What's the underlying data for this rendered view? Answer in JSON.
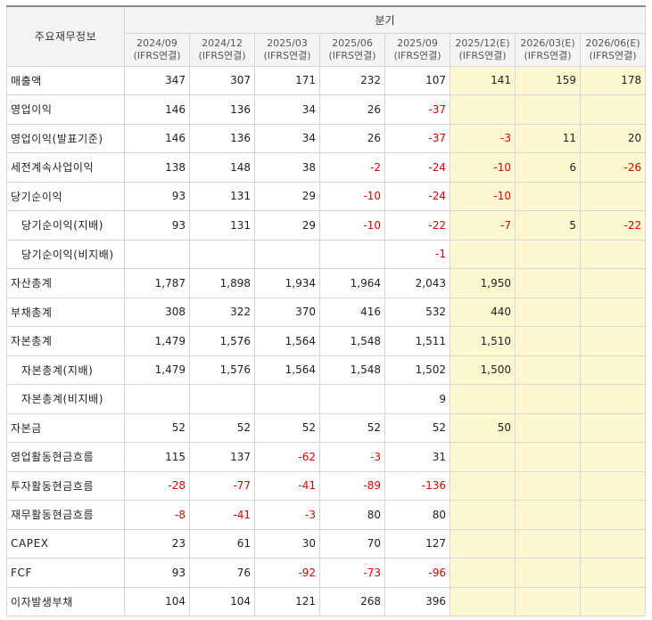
{
  "header": {
    "corner_label": "주요재무정보",
    "group_label": "분기",
    "periods": [
      {
        "date": "2024/09",
        "basis": "(IFRS연결)",
        "estimate": false
      },
      {
        "date": "2024/12",
        "basis": "(IFRS연결)",
        "estimate": false
      },
      {
        "date": "2025/03",
        "basis": "(IFRS연결)",
        "estimate": false
      },
      {
        "date": "2025/06",
        "basis": "(IFRS연결)",
        "estimate": false
      },
      {
        "date": "2025/09",
        "basis": "(IFRS연결)",
        "estimate": false
      },
      {
        "date": "2025/12(E)",
        "basis": "(IFRS연결)",
        "estimate": true
      },
      {
        "date": "2026/03(E)",
        "basis": "(IFRS연결)",
        "estimate": true
      },
      {
        "date": "2026/06(E)",
        "basis": "(IFRS연결)",
        "estimate": true
      }
    ]
  },
  "rows": [
    {
      "label": "매출액",
      "indent": false,
      "values": [
        "347",
        "307",
        "171",
        "232",
        "107",
        "141",
        "159",
        "178"
      ]
    },
    {
      "label": "영업이익",
      "indent": false,
      "values": [
        "146",
        "136",
        "34",
        "26",
        "-37",
        "",
        "",
        ""
      ]
    },
    {
      "label": "영업이익(발표기준)",
      "indent": false,
      "values": [
        "146",
        "136",
        "34",
        "26",
        "-37",
        "-3",
        "11",
        "20"
      ]
    },
    {
      "label": "세전계속사업이익",
      "indent": false,
      "values": [
        "138",
        "148",
        "38",
        "-2",
        "-24",
        "-10",
        "6",
        "-26"
      ]
    },
    {
      "label": "당기순이익",
      "indent": false,
      "values": [
        "93",
        "131",
        "29",
        "-10",
        "-24",
        "-10",
        "",
        ""
      ]
    },
    {
      "label": "당기순이익(지배)",
      "indent": true,
      "values": [
        "93",
        "131",
        "29",
        "-10",
        "-22",
        "-7",
        "5",
        "-22"
      ]
    },
    {
      "label": "당기순이익(비지배)",
      "indent": true,
      "values": [
        "",
        "",
        "",
        "",
        "-1",
        "",
        "",
        ""
      ]
    },
    {
      "label": "자산총계",
      "indent": false,
      "values": [
        "1,787",
        "1,898",
        "1,934",
        "1,964",
        "2,043",
        "1,950",
        "",
        ""
      ]
    },
    {
      "label": "부채총계",
      "indent": false,
      "values": [
        "308",
        "322",
        "370",
        "416",
        "532",
        "440",
        "",
        ""
      ]
    },
    {
      "label": "자본총계",
      "indent": false,
      "values": [
        "1,479",
        "1,576",
        "1,564",
        "1,548",
        "1,511",
        "1,510",
        "",
        ""
      ]
    },
    {
      "label": "자본총계(지배)",
      "indent": true,
      "values": [
        "1,479",
        "1,576",
        "1,564",
        "1,548",
        "1,502",
        "1,500",
        "",
        ""
      ]
    },
    {
      "label": "자본총계(비지배)",
      "indent": true,
      "values": [
        "",
        "",
        "",
        "",
        "9",
        "",
        "",
        ""
      ]
    },
    {
      "label": "자본금",
      "indent": false,
      "values": [
        "52",
        "52",
        "52",
        "52",
        "52",
        "50",
        "",
        ""
      ]
    },
    {
      "label": "영업활동현금흐름",
      "indent": false,
      "values": [
        "115",
        "137",
        "-62",
        "-3",
        "31",
        "",
        "",
        ""
      ]
    },
    {
      "label": "투자활동현금흐름",
      "indent": false,
      "values": [
        "-28",
        "-77",
        "-41",
        "-89",
        "-136",
        "",
        "",
        ""
      ]
    },
    {
      "label": "재무활동현금흐름",
      "indent": false,
      "values": [
        "-8",
        "-41",
        "-3",
        "80",
        "80",
        "",
        "",
        ""
      ]
    },
    {
      "label": "CAPEX",
      "indent": false,
      "values": [
        "23",
        "61",
        "30",
        "70",
        "127",
        "",
        "",
        ""
      ]
    },
    {
      "label": "FCF",
      "indent": false,
      "values": [
        "93",
        "76",
        "-92",
        "-73",
        "-96",
        "",
        "",
        ""
      ]
    },
    {
      "label": "이자발생부채",
      "indent": false,
      "values": [
        "104",
        "104",
        "121",
        "268",
        "396",
        "",
        "",
        ""
      ]
    }
  ],
  "colors": {
    "negative": "#e00000",
    "estimate_bg": "#fdf8cf",
    "header_bg": "#f4f4f4",
    "border": "#d6d6d6"
  }
}
